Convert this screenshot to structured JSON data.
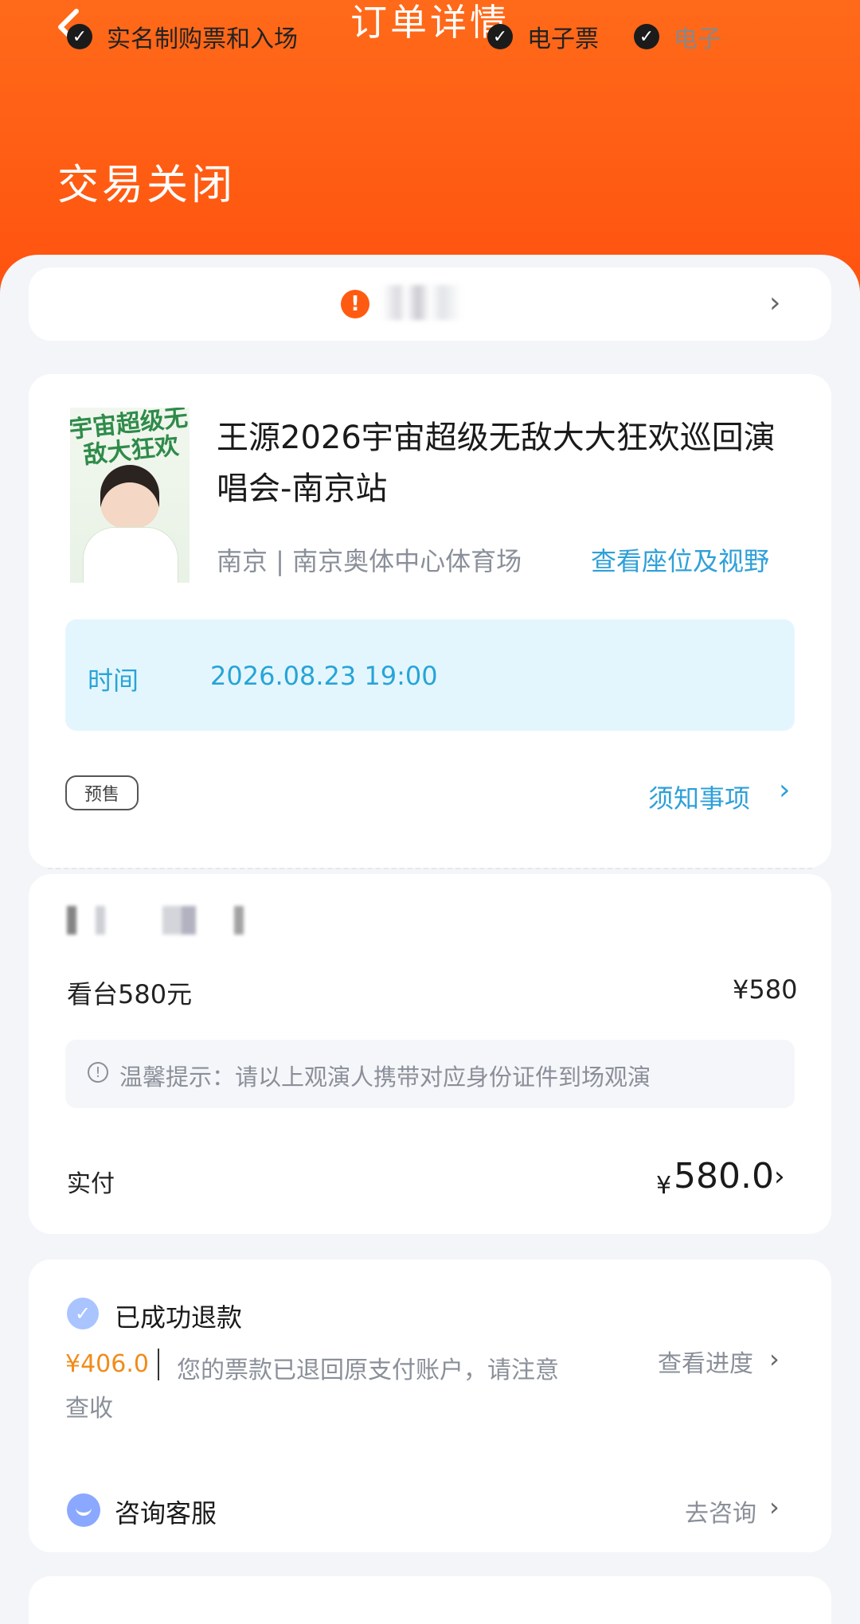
{
  "header": {
    "title": "订单详情",
    "status": "交易关闭",
    "back_icon": "chevron-left-icon"
  },
  "tags": {
    "items": [
      {
        "label": "实名制购票和入场",
        "icon": "check-circle-icon"
      },
      {
        "label": "电子票",
        "icon": "check-circle-icon"
      },
      {
        "label": "电子",
        "icon": "check-circle-icon"
      }
    ],
    "warning_icon": "exclamation-icon",
    "more_icon": "chevron-right-icon"
  },
  "event": {
    "poster_text": "宇宙超级无敌大狂欢",
    "title": "王源2026宇宙超级无敌大大狂欢巡回演唱会-南京站",
    "venue": "南京 | 南京奥体中心体育场",
    "seat_link": "查看座位及视野",
    "time_label": "时间",
    "time_value": "2026.08.23 19:00",
    "badge": "预售",
    "notice_link": "须知事项"
  },
  "ticket": {
    "name": "看台580元",
    "price": "¥580",
    "tip": "温馨提示：请以上观演人携带对应身份证件到场观演",
    "paid_label": "实付",
    "paid_currency": "¥",
    "paid_amount": "580.0"
  },
  "refund": {
    "title": "已成功退款",
    "amount": "¥406.0",
    "message_line1": "您的票款已退回原支付账户，请注意",
    "message_line2": "查收",
    "progress_link": "查看进度"
  },
  "support": {
    "title": "咨询客服",
    "link": "去咨询"
  },
  "colors": {
    "header": "#ff5a12",
    "link_blue": "#2ea0d8",
    "refund_orange": "#f08c1a"
  }
}
